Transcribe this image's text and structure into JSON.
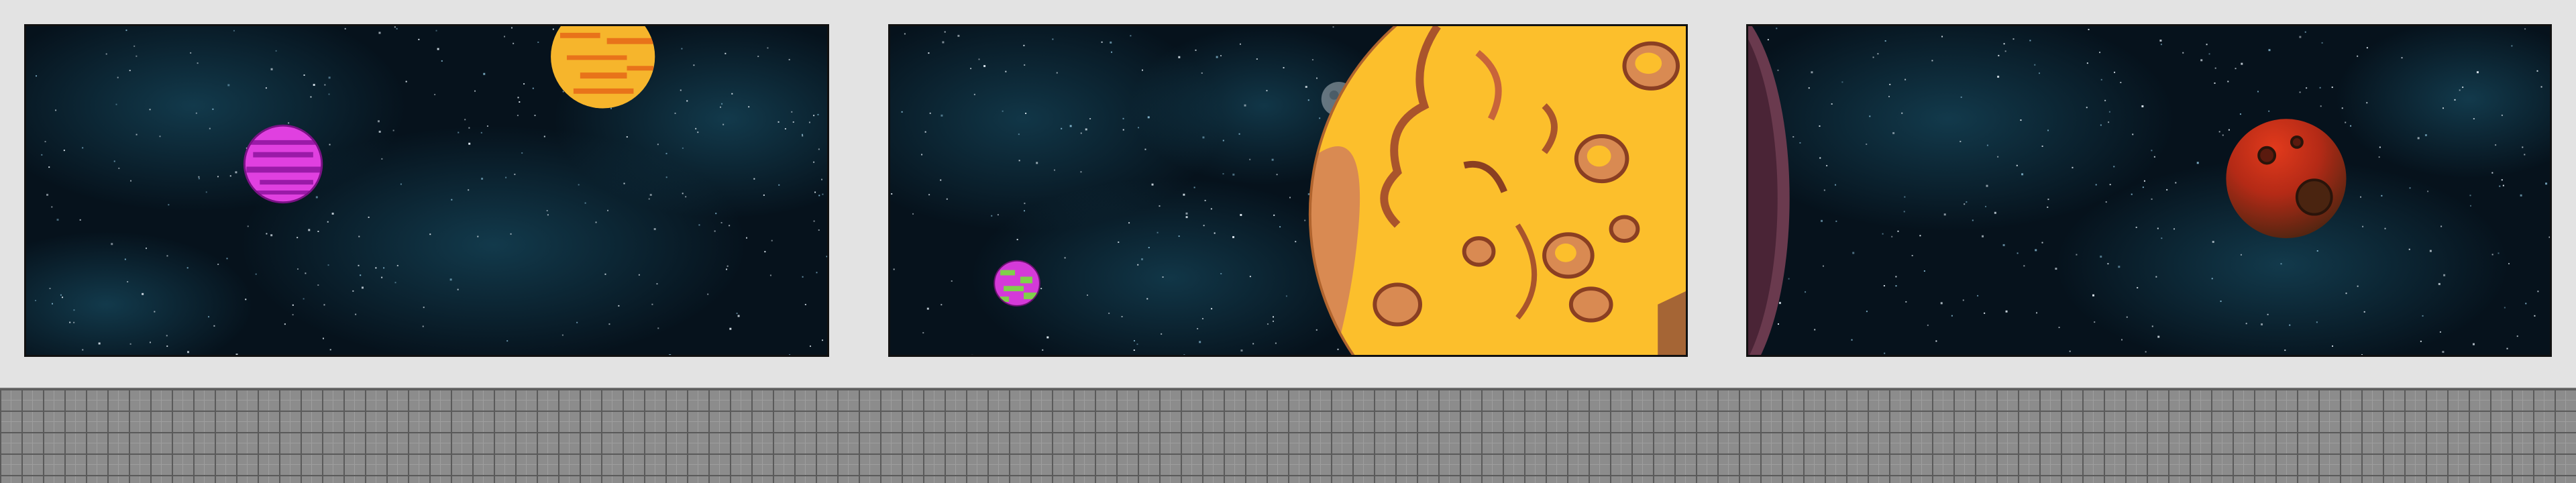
{
  "scene": {
    "panels": [
      {
        "name": "space-panel-left",
        "planets": [
          {
            "type": "gas-giant",
            "color": "#e040e0",
            "band_color": "#9a1aa8"
          },
          {
            "type": "gas-giant",
            "color": "#f6b52c",
            "band_color": "#e8731a"
          }
        ]
      },
      {
        "name": "space-panel-center",
        "planets": [
          {
            "type": "cratered-moon",
            "color": "#fcbf2c",
            "shadow_color": "#d98a52"
          },
          {
            "type": "swirl-planet",
            "color": "#d43ad8",
            "accent_color": "#7fd04a"
          },
          {
            "type": "ghost-moon",
            "color": "#cfd6dc"
          }
        ]
      },
      {
        "name": "space-panel-right",
        "planets": [
          {
            "type": "cratered-planet",
            "color": "#c0301c",
            "shadow_color": "#4a2410"
          },
          {
            "type": "planet-edge",
            "color": "#6a3a4e"
          }
        ]
      }
    ],
    "colors": {
      "space_bg": "#06121c",
      "nebula": "#1c5a72",
      "frame_border": "#111111",
      "page_bg": "#e3e3e3",
      "floor_tile": "#8c8c8c"
    }
  }
}
